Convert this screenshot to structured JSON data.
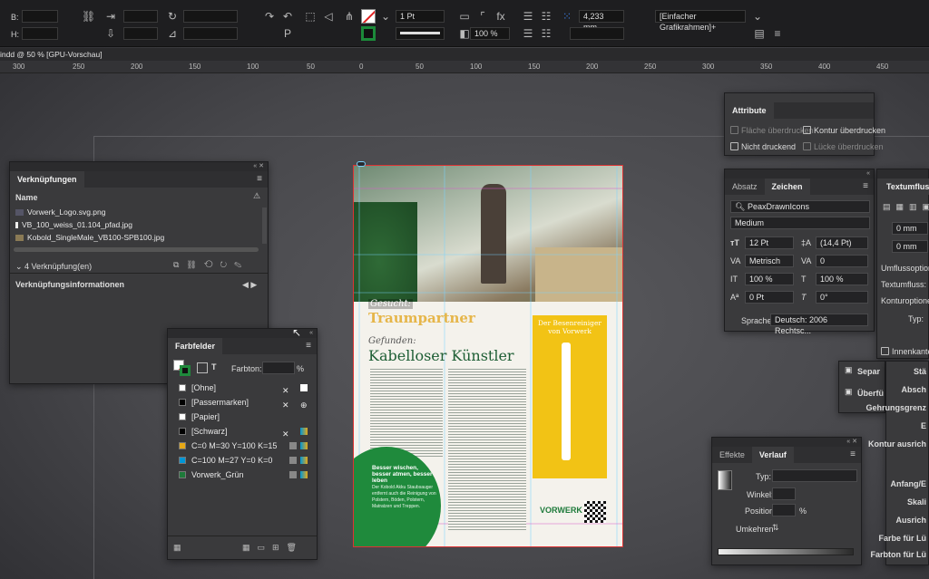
{
  "controlbar": {
    "b_label": "B:",
    "h_label": "H:",
    "stroke_weight": "1 Pt",
    "percent": "100 %",
    "dimension": "4,233 mm",
    "frame_style": "[Einfacher Grafikrahmen]+"
  },
  "doc_tab": "indd @ 50 % [GPU-Vorschau]",
  "ruler": [
    "300",
    "250",
    "200",
    "150",
    "100",
    "50",
    "0",
    "50",
    "100",
    "150",
    "200",
    "250",
    "300",
    "350",
    "400",
    "450"
  ],
  "layout": {
    "headline_kicker": "Gesucht:",
    "headline_big": "Traumpartner",
    "sub_kicker": "Gefunden:",
    "sub_title": "Kabelloser Künstler",
    "side_title": "Der Besenreiniger von Vorwerk",
    "brand": "VORWERK",
    "green_box_title": "Besser wischen, besser atmen, besser leben",
    "green_box_text": "Der Kobold Akku Staubsauger entfernt auch die Reinigung von Polstern, Böden, Polstern, Matratzen und Treppen."
  },
  "verknuepfungen": {
    "tab": "Verknüpfungen",
    "col_name": "Name",
    "items": [
      "Vorwerk_Logo.svg.png",
      "VB_100_weiss_01.104_pfad.jpg",
      "Kobold_SingleMale_VB100-SPB100.jpg"
    ],
    "count": "4 Verknüpfung(en)",
    "info": "Verknüpfungsinformationen"
  },
  "farbfelder": {
    "tab": "Farbfelder",
    "tint_label": "Farbton:",
    "tint_unit": "%",
    "swatches": [
      {
        "name": "[Ohne]",
        "color": "#ffffff"
      },
      {
        "name": "[Passermarken]",
        "color": "#000000"
      },
      {
        "name": "[Papier]",
        "color": "#ffffff"
      },
      {
        "name": "[Schwarz]",
        "color": "#000000"
      },
      {
        "name": "C=0 M=30 Y=100 K=15",
        "color": "#e6a817"
      },
      {
        "name": "C=100 M=27 Y=0 K=0",
        "color": "#0096d6"
      },
      {
        "name": "Vorwerk_Grün",
        "color": "#1e7a3a"
      }
    ]
  },
  "attribute": {
    "tab": "Attribute",
    "flaeche": "Fläche überdrucken",
    "kontur": "Kontur überdrucken",
    "nicht_druckend": "Nicht druckend",
    "luecke": "Lücke überdrucken"
  },
  "zeichen": {
    "tab_absatz": "Absatz",
    "tab_zeichen": "Zeichen",
    "font": "PeaxDrawnIcons",
    "style": "Medium",
    "size": "12 Pt",
    "leading": "(14,4 Pt)",
    "kerning": "Metrisch",
    "tracking": "0",
    "vscale": "100 %",
    "hscale": "100 %",
    "baseline": "0 Pt",
    "skew": "0°",
    "language_label": "Sprache:",
    "language": "Deutsch: 2006 Rechtsc..."
  },
  "textumfluss": {
    "tab": "Textumfluss",
    "v1": "0 mm",
    "v2": "0 mm",
    "opt": "Umflussoptionen",
    "flow": "Textumfluss:",
    "kontur": "Konturoptionen:",
    "typ": "Typ:",
    "innen": "Innenkante"
  },
  "separation": {
    "a": "Separ",
    "b": "Überfü"
  },
  "right_labels": [
    "Stä",
    "Absch",
    "Gehrungsgrenz",
    "E",
    "Kontur ausrich",
    "Anfang/E",
    "Skali",
    "Ausrich",
    "Farbe für Lü",
    "Farbton für Lü"
  ],
  "verlauf": {
    "tab_effekte": "Effekte",
    "tab_verlauf": "Verlauf",
    "typ": "Typ:",
    "winkel": "Winkel:",
    "position": "Position:",
    "pos_unit": "%",
    "umkehren": "Umkehren"
  }
}
